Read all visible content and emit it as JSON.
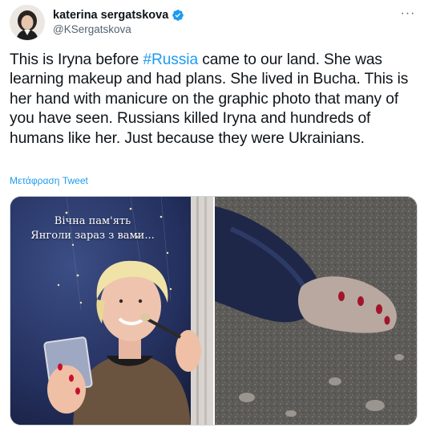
{
  "author": {
    "display_name": "katerina sergatskova",
    "handle": "@KSergatskova",
    "verified": true,
    "avatar_icon": "profile-photo"
  },
  "header": {
    "more_icon": "more-horizontal-icon",
    "more_label": "···"
  },
  "tweet": {
    "text_before_hashtag": "This is Iryna before ",
    "hashtag": "#Russia",
    "text_after_hashtag": " came to our land. She was learning makeup and had plans. She lived in Bucha. This is her hand with manicure on the graphic photo that many of you have seen. Russians killed Iryna and hundreds of humans like her. Just because they were Ukrainians.",
    "translate_label": "Μετάφραση Tweet"
  },
  "media": {
    "left_caption_line1": "Вічна пам'ять",
    "left_caption_line2": "Янголи зараз з вами..."
  },
  "colors": {
    "link": "#1d9bf0",
    "text": "#0f1419",
    "secondary": "#536471",
    "border": "#cfd9de"
  }
}
